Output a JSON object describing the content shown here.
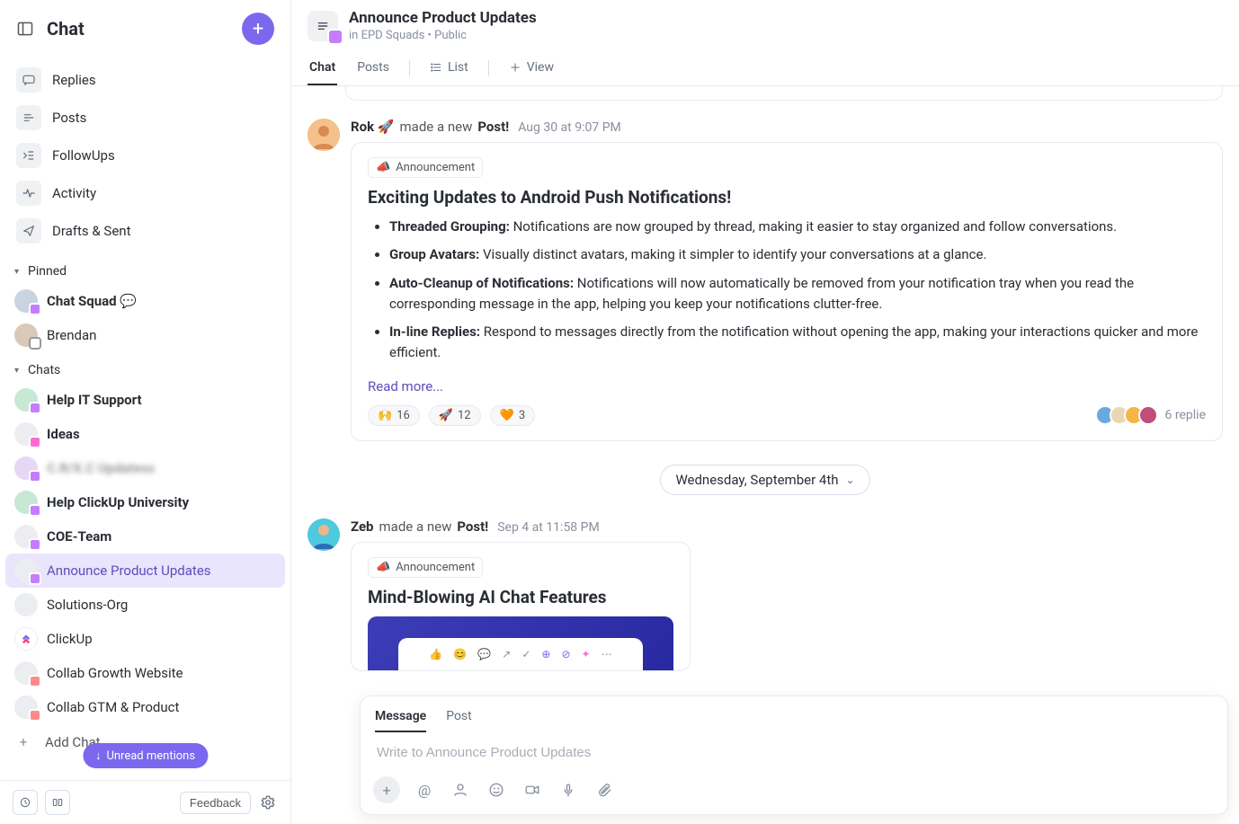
{
  "sidebar": {
    "title": "Chat",
    "nav": [
      {
        "label": "Replies",
        "icon": "replies"
      },
      {
        "label": "Posts",
        "icon": "posts"
      },
      {
        "label": "FollowUps",
        "icon": "followups"
      },
      {
        "label": "Activity",
        "icon": "activity"
      },
      {
        "label": "Drafts & Sent",
        "icon": "drafts"
      }
    ],
    "pinned_header": "Pinned",
    "pinned": [
      {
        "label": "Chat Squad 💬",
        "bold": true
      },
      {
        "label": "Brendan",
        "bold": false
      }
    ],
    "chats_header": "Chats",
    "chats": [
      {
        "label": "Help IT Support",
        "bold": true,
        "active": false
      },
      {
        "label": "Ideas",
        "bold": true,
        "active": false
      },
      {
        "label": "C.R/X.C Updatess",
        "bold": true,
        "active": false,
        "blurred": true
      },
      {
        "label": "Help ClickUp University",
        "bold": true,
        "active": false
      },
      {
        "label": "COE-Team",
        "bold": true,
        "active": false
      },
      {
        "label": "Announce Product Updates",
        "bold": false,
        "active": true
      },
      {
        "label": "Solutions-Org",
        "bold": false,
        "active": false
      },
      {
        "label": "ClickUp",
        "bold": false,
        "active": false
      },
      {
        "label": "Collab Growth Website",
        "bold": false,
        "active": false
      },
      {
        "label": "Collab GTM & Product",
        "bold": false,
        "active": false
      }
    ],
    "add_chat_label": "Add Chat",
    "unread_pill": "Unread mentions",
    "feedback_label": "Feedback"
  },
  "header": {
    "title": "Announce Product Updates",
    "breadcrumb_prefix": "in ",
    "breadcrumb_space": "EPD Squads",
    "visibility": "Public",
    "tabs": [
      {
        "label": "Chat",
        "id": "chat",
        "active": true
      },
      {
        "label": "Posts",
        "id": "posts",
        "active": false
      },
      {
        "label": "List",
        "id": "list",
        "icon": "list",
        "active": false
      },
      {
        "label": "View",
        "id": "view",
        "icon": "plus",
        "active": false
      }
    ]
  },
  "feed": {
    "post1": {
      "author": "Rok 🚀",
      "action": "made a new",
      "action_bold": "Post!",
      "time": "Aug 30 at 9:07 PM",
      "tag": "Announcement",
      "title": "Exciting Updates to Android Push Notifications!",
      "bullets": [
        {
          "b": "Threaded Grouping:",
          "t": " Notifications are now grouped by thread, making it easier to stay organized and follow conversations."
        },
        {
          "b": "Group Avatars:",
          "t": " Visually distinct avatars, making it simpler to identify your conversations at a glance."
        },
        {
          "b": "Auto-Cleanup of Notifications:",
          "t": " Notifications will now automatically be removed from your notification tray when you read the corresponding message in the app, helping you keep your notifications clutter-free."
        },
        {
          "b": "In-line Replies:",
          "t": " Respond to messages directly from the notification without opening the app, making your interactions quicker and more efficient."
        }
      ],
      "readmore": "Read more...",
      "reactions": [
        {
          "emoji": "🙌",
          "count": "16"
        },
        {
          "emoji": "🚀",
          "count": "12"
        },
        {
          "emoji": "🧡",
          "count": "3"
        }
      ],
      "replies_text": "6 replie"
    },
    "date_divider": "Wednesday, September 4th",
    "post2": {
      "author": "Zeb",
      "action": "made a new",
      "action_bold": "Post!",
      "time": "Sep 4 at 11:58 PM",
      "tag": "Announcement",
      "title": "Mind-Blowing AI Chat Features"
    }
  },
  "composer": {
    "tabs": [
      {
        "label": "Message",
        "active": true
      },
      {
        "label": "Post",
        "active": false
      }
    ],
    "placeholder": "Write to Announce Product Updates"
  }
}
